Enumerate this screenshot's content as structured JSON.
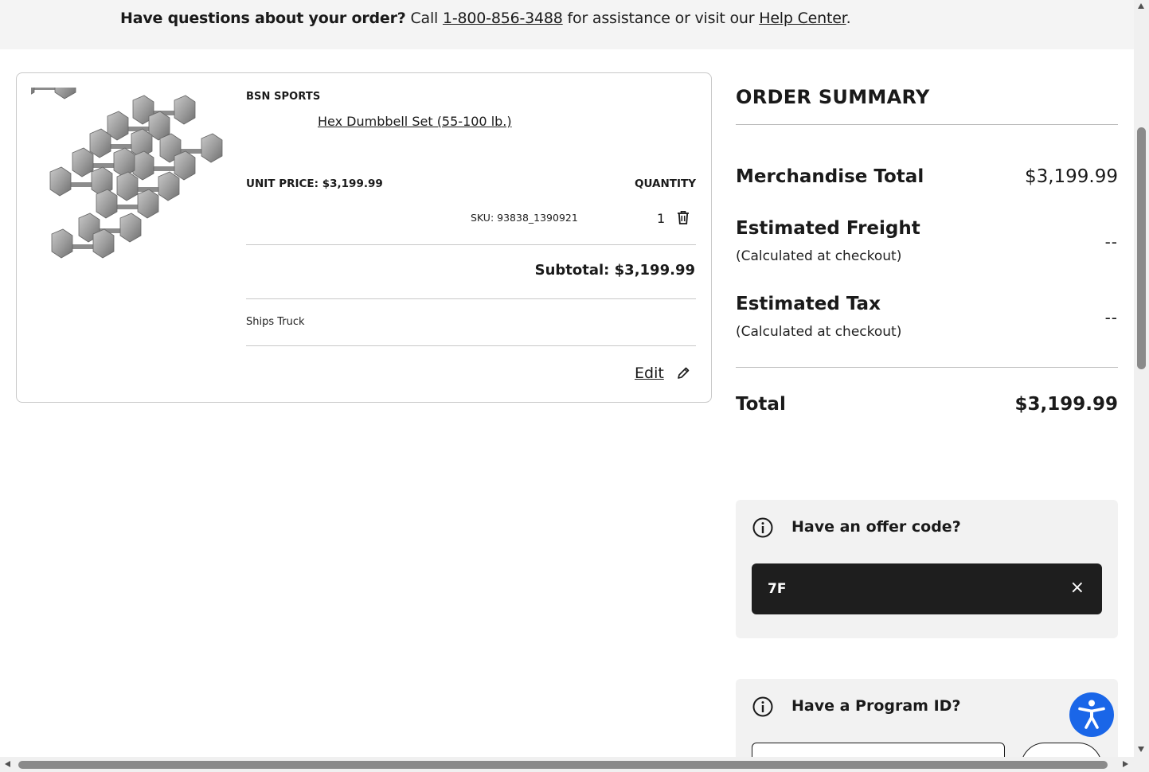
{
  "banner": {
    "question": "Have questions about your order?",
    "call": "Call",
    "phone": "1-800-856-3488",
    "middle": "for assistance or visit our",
    "help_link": "Help Center",
    "end": "."
  },
  "cart_item": {
    "brand": "BSN SPORTS",
    "product_name": "Hex Dumbbell Set (55-100 lb.)",
    "unit_price_label": "UNIT PRICE:",
    "unit_price": "$3,199.99",
    "quantity_label": "QUANTITY",
    "sku": "SKU: 93838_1390921",
    "quantity": "1",
    "subtotal": "Subtotal: $3,199.99",
    "shipping": "Ships Truck",
    "edit_label": "Edit",
    "image_icon": "dumbbell-set-photo",
    "trash_icon": "trash-icon",
    "edit_icon": "pencil-icon"
  },
  "summary": {
    "title": "ORDER SUMMARY",
    "merchandise_label": "Merchandise Total",
    "merchandise_value": "$3,199.99",
    "freight_label": "Estimated Freight",
    "freight_note": "(Calculated at checkout)",
    "freight_value": "--",
    "tax_label": "Estimated Tax",
    "tax_note": "(Calculated at checkout)",
    "tax_value": "--",
    "total_label": "Total",
    "total_value": "$3,199.99"
  },
  "offer": {
    "title": "Have an offer code?",
    "code": "7F",
    "remove_symbol": "×"
  },
  "program": {
    "title": "Have a Program ID?"
  },
  "colors": {
    "banner_bg": "#f4f4f4",
    "panel_bg": "#f2f2f2",
    "chip_bg": "#1e1e1e",
    "accessibility_blue": "#1a66e8"
  }
}
